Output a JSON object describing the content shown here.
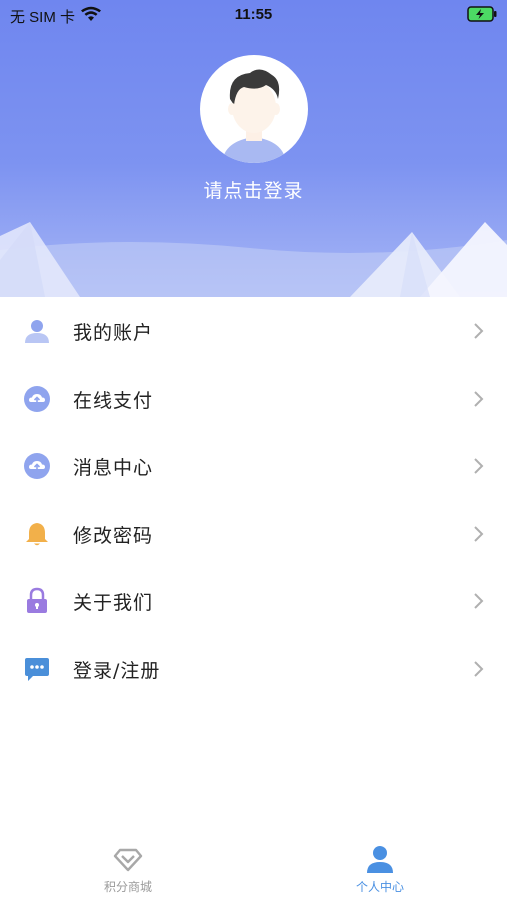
{
  "status_bar": {
    "carrier": "无 SIM 卡",
    "time": "11:55"
  },
  "profile": {
    "login_prompt": "请点击登录"
  },
  "menu": {
    "items": [
      {
        "label": "我的账户",
        "icon": "user-icon",
        "icon_color": "#8fa4ee"
      },
      {
        "label": "在线支付",
        "icon": "cloud-upload-icon",
        "icon_color": "#8fa4ee"
      },
      {
        "label": "消息中心",
        "icon": "cloud-upload-icon",
        "icon_color": "#8fa4ee"
      },
      {
        "label": "修改密码",
        "icon": "bell-icon",
        "icon_color": "#f2b04a"
      },
      {
        "label": "关于我们",
        "icon": "lock-icon",
        "icon_color": "#9a7be0"
      },
      {
        "label": "登录/注册",
        "icon": "chat-icon",
        "icon_color": "#4a8fd9"
      }
    ]
  },
  "tab_bar": {
    "tabs": [
      {
        "label": "积分商城",
        "icon": "diamond-icon",
        "active": false
      },
      {
        "label": "个人中心",
        "icon": "person-icon",
        "active": true
      }
    ]
  },
  "colors": {
    "header_top": "#6f86ef",
    "accent": "#4a90e2",
    "inactive": "#9a9a9a"
  }
}
